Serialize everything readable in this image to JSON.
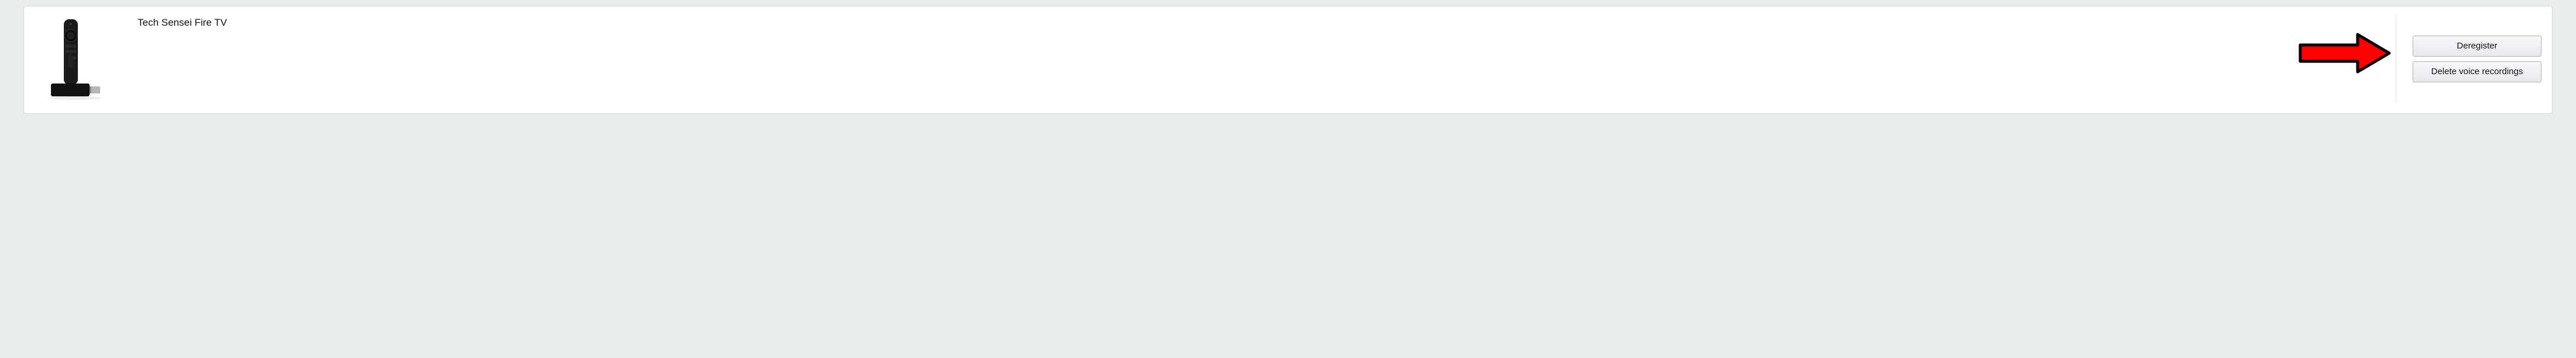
{
  "device": {
    "name": "Tech Sensei Fire TV",
    "image_alt": "fire-tv-stick"
  },
  "actions": {
    "deregister": "Deregister",
    "delete_voice": "Delete voice recordings"
  },
  "annotation": {
    "arrow_color": "#ff0000",
    "arrow_stroke": "#000000"
  }
}
